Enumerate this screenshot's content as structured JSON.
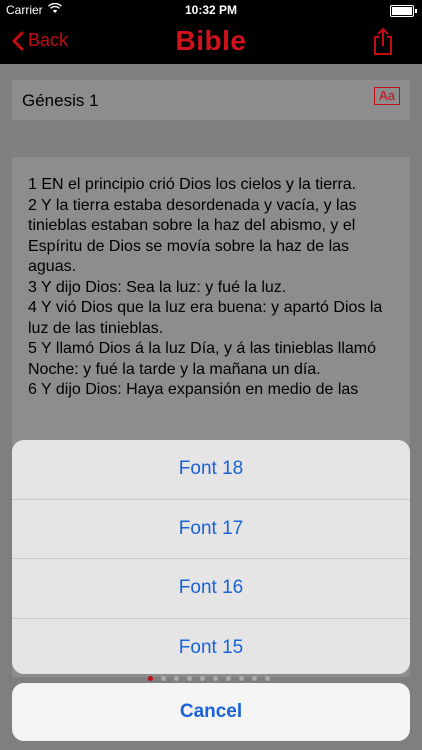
{
  "status": {
    "carrier": "Carrier",
    "time": "10:32 PM"
  },
  "nav": {
    "back_label": "Back",
    "title": "Bible"
  },
  "header": {
    "chapter": "Génesis 1",
    "font_button": "Aa"
  },
  "verses": [
    "1 EN el principio crió Dios los cielos y la tierra.",
    "2 Y la tierra estaba desordenada y vacía, y las tinieblas estaban sobre la haz del abismo, y el Espíritu de Dios se movía sobre la haz de las aguas.",
    "3 Y dijo Dios: Sea la luz: y fué la luz.",
    "4 Y vió Dios que la luz era buena: y apartó Dios la luz de las tinieblas.",
    "5 Y llamó Dios á la luz Día, y á las tinieblas llamó Noche: y fué la tarde y la mañana un día.",
    "6 Y dijo Dios: Haya expansión en medio de las"
  ],
  "action_sheet": {
    "options": [
      "Font 18",
      "Font 17",
      "Font 16",
      "Font 15"
    ],
    "cancel": "Cancel"
  },
  "colors": {
    "accent": "#c40c15",
    "link": "#1a62d6"
  }
}
